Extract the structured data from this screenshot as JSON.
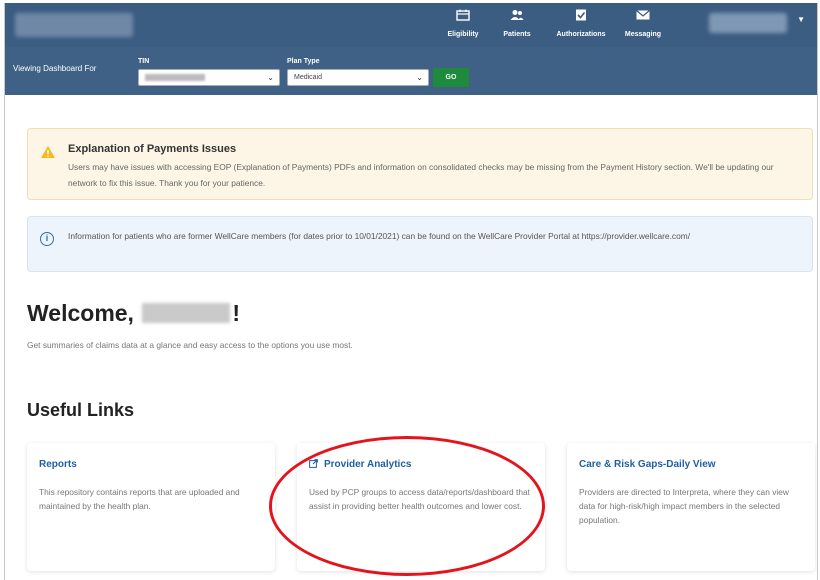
{
  "nav": {
    "items": [
      {
        "label": "Eligibility",
        "icon": "calendar-icon"
      },
      {
        "label": "Patients",
        "icon": "people-icon"
      },
      {
        "label": "Authorizations",
        "icon": "checkbox-icon"
      },
      {
        "label": "Messaging",
        "icon": "envelope-icon"
      }
    ]
  },
  "filter": {
    "viewing_label": "Viewing Dashboard For",
    "tin_label": "TIN",
    "plan_type_label": "Plan Type",
    "plan_type_value": "Medicaid",
    "go_label": "GO"
  },
  "alerts": {
    "warning": {
      "title": "Explanation of Payments Issues",
      "text": "Users may have issues with accessing EOP (Explanation of Payments) PDFs and information on consolidated checks may be missing from the Payment History section. We'll be updating our network to fix this issue.  Thank you for your patience."
    },
    "info": {
      "text": "Information for patients who are former WellCare members (for dates prior to 10/01/2021) can be found on the WellCare Provider Portal at https://provider.wellcare.com/"
    }
  },
  "welcome": {
    "greeting": "Welcome,",
    "exclamation": "!",
    "subtitle": "Get summaries of claims data at a glance and easy access to the options you use most."
  },
  "useful_links": {
    "title": "Useful Links",
    "cards": [
      {
        "title": "Reports",
        "description": "This repository contains reports that are uploaded and maintained by the health plan."
      },
      {
        "title": "Provider Analytics",
        "description": "Used by PCP groups to access data/reports/dashboard that assist in providing better health outcomes and lower cost."
      },
      {
        "title": "Care & Risk Gaps-Daily View",
        "description": "Providers are directed to Interpreta, where they can view data for high-risk/high impact members in the selected population."
      }
    ]
  },
  "colors": {
    "nav_bg": "#3b5d82",
    "go_button": "#1e8a3c",
    "link": "#1f5fa6",
    "annotation": "#e3141c"
  }
}
